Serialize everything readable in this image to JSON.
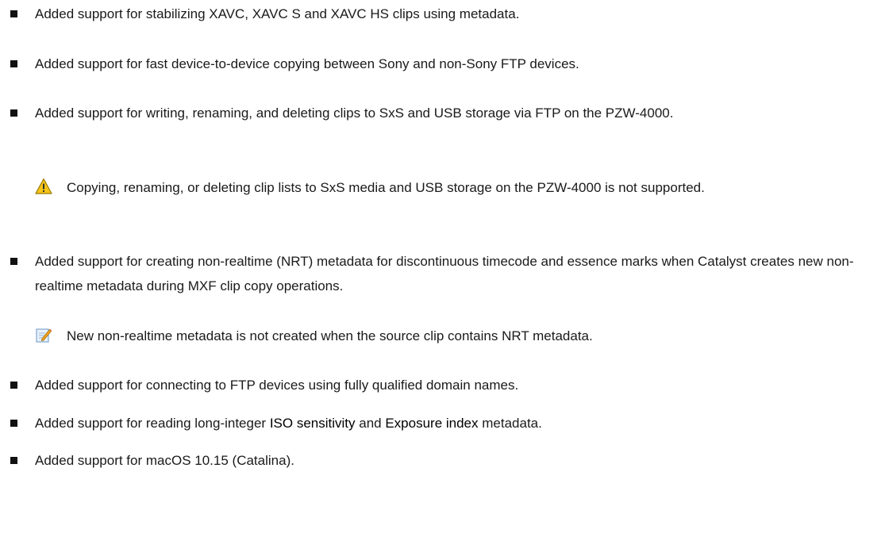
{
  "bullets": [
    {
      "text": "Added support for stabilizing XAVC, XAVC S and XAVC HS clips using metadata."
    },
    {
      "text": "Added support for fast device-to-device copying between Sony and non-Sony FTP devices."
    },
    {
      "text": "Added support for writing, renaming, and deleting clips to SxS and USB storage via FTP on the PZW-4000."
    },
    {
      "text": "Added support for creating non-realtime (NRT) metadata for discontinuous timecode and essence marks when Catalyst creates new non-realtime metadata during MXF clip copy operations."
    },
    {
      "text": "Added support for connecting to FTP devices using fully qualified domain names."
    },
    {
      "prefix": "Added support for reading long-integer ",
      "term1": "ISO sensitivity",
      "mid": " and ",
      "term2": "Exposure index",
      "suffix": " metadata."
    },
    {
      "text": "Added support for macOS 10.15 (Catalina)."
    }
  ],
  "notes": [
    {
      "icon": "warning-icon",
      "text": "Copying, renaming, or deleting clip lists to SxS media and USB storage on the PZW-4000 is not supported."
    },
    {
      "icon": "note-pencil-icon",
      "text": "New non-realtime metadata is not created when the source clip contains NRT metadata."
    }
  ]
}
